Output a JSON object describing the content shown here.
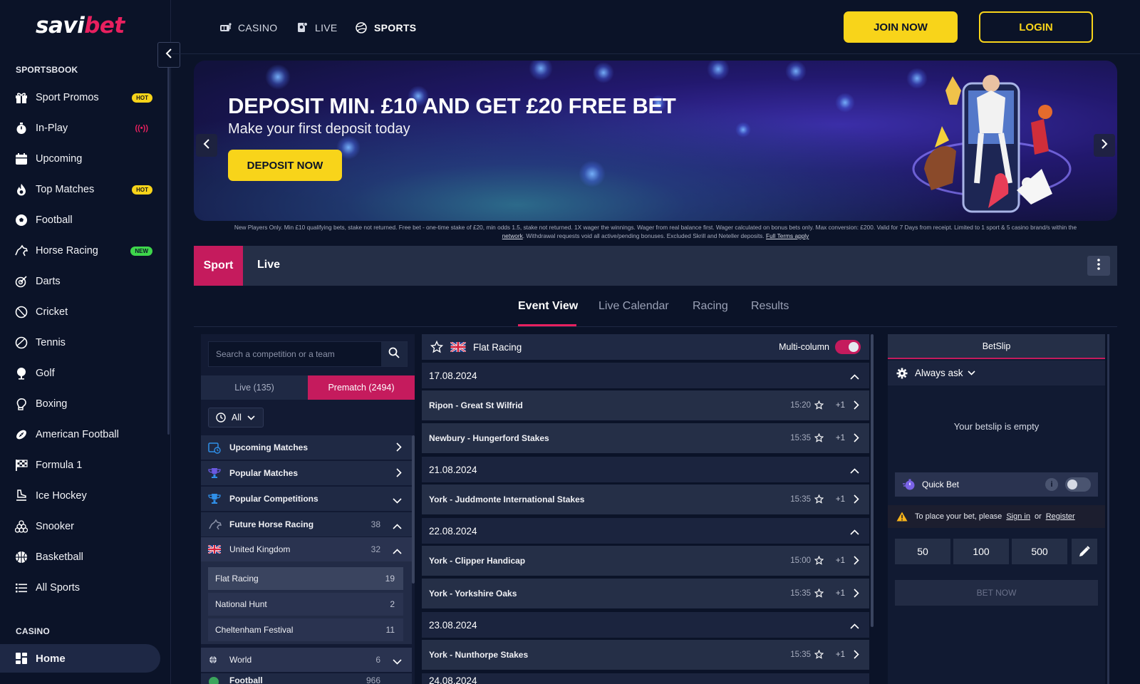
{
  "brand": {
    "logo_a": "savi",
    "logo_b": "bet"
  },
  "sidebar": {
    "heading_sportsbook": "SPORTSBOOK",
    "items": [
      {
        "label": "Sport Promos",
        "badge": "HOT"
      },
      {
        "label": "In-Play",
        "badge": "((•))"
      },
      {
        "label": "Upcoming",
        "badge": ""
      },
      {
        "label": "Top Matches",
        "badge": "HOT"
      },
      {
        "label": "Football",
        "badge": ""
      },
      {
        "label": "Horse Racing",
        "badge": "NEW"
      },
      {
        "label": "Darts",
        "badge": ""
      },
      {
        "label": "Cricket",
        "badge": ""
      },
      {
        "label": "Tennis",
        "badge": ""
      },
      {
        "label": "Golf",
        "badge": ""
      },
      {
        "label": "Boxing",
        "badge": ""
      },
      {
        "label": "American Football",
        "badge": ""
      },
      {
        "label": "Formula 1",
        "badge": ""
      },
      {
        "label": "Ice Hockey",
        "badge": ""
      },
      {
        "label": "Snooker",
        "badge": ""
      },
      {
        "label": "Basketball",
        "badge": ""
      },
      {
        "label": "All Sports",
        "badge": ""
      }
    ],
    "heading_casino": "CASINO",
    "home_label": "Home"
  },
  "topnav": {
    "casino": "CASINO",
    "live": "LIVE",
    "sports": "SPORTS",
    "join": "JOIN NOW",
    "login": "LOGIN"
  },
  "banner": {
    "headline": "DEPOSIT MIN. £10 AND GET £20 FREE BET",
    "subline": "Make your first deposit today",
    "cta": "DEPOSIT NOW",
    "terms_1": "New Players Only. Min £10 qualifying bets, stake not returned. Free bet - one-time stake of £20, min odds 1.5, stake not returned. 1X wager the winnings. Wager from real balance first. Wager calculated on bonus bets only. Max conversion: £200. Valid for 7 Days from receipt. Limited to 1 sport & 5 casino brand/s within the",
    "terms_link1": "network",
    "terms_2": ". Withdrawal requests void all active/pending bonuses. Excluded Skrill and Neteller deposits.",
    "terms_link2": "Full Terms apply"
  },
  "mode_tabs": {
    "sport": "Sport",
    "live": "Live"
  },
  "subtabs": [
    "Event View",
    "Live Calendar",
    "Racing",
    "Results"
  ],
  "filter": {
    "search_placeholder": "Search a competition or a team",
    "tab_live": "Live (135)",
    "tab_prematch": "Prematch (2494)",
    "time_select": "All",
    "rows": {
      "upcoming": "Upcoming Matches",
      "popular_matches": "Popular Matches",
      "popular_competitions": "Popular Competitions",
      "future_horse": "Future Horse Racing",
      "future_horse_count": "38",
      "uk": "United Kingdom",
      "uk_count": "32",
      "world": "World",
      "world_count": "6",
      "football": "Football",
      "football_count": "966"
    },
    "subitems": [
      {
        "label": "Flat Racing",
        "count": "19"
      },
      {
        "label": "National Hunt",
        "count": "2"
      },
      {
        "label": "Cheltenham Festival",
        "count": "11"
      }
    ]
  },
  "events": {
    "header": "Flat Racing",
    "multi_column": "Multi-column",
    "groups": [
      {
        "date": "17.08.2024",
        "events": [
          {
            "name": "Ripon - Great St Wilfrid",
            "time": "15:20",
            "more": "+1"
          },
          {
            "name": "Newbury - Hungerford Stakes",
            "time": "15:35",
            "more": "+1"
          }
        ]
      },
      {
        "date": "21.08.2024",
        "events": [
          {
            "name": "York - Juddmonte International Stakes",
            "time": "15:35",
            "more": "+1"
          }
        ]
      },
      {
        "date": "22.08.2024",
        "events": [
          {
            "name": "York - Clipper Handicap",
            "time": "15:00",
            "more": "+1"
          },
          {
            "name": "York - Yorkshire Oaks",
            "time": "15:35",
            "more": "+1"
          }
        ]
      },
      {
        "date": "23.08.2024",
        "events": [
          {
            "name": "York - Nunthorpe Stakes",
            "time": "15:35",
            "more": "+1"
          }
        ]
      },
      {
        "date": "24.08.2024",
        "events": []
      }
    ]
  },
  "betslip": {
    "title": "BetSlip",
    "always_ask": "Always ask",
    "empty": "Your betslip is empty",
    "quick_bet": "Quick Bet",
    "info": "i",
    "warn_text": "To place your bet, please",
    "sign_in": "Sign in",
    "or": "or",
    "register": "Register",
    "stakes": [
      "50",
      "100",
      "500"
    ],
    "bet_now": "BET NOW"
  },
  "colors": {
    "accent": "#c51b5d",
    "yellow": "#f8d41a",
    "bg": "#0b1328"
  }
}
